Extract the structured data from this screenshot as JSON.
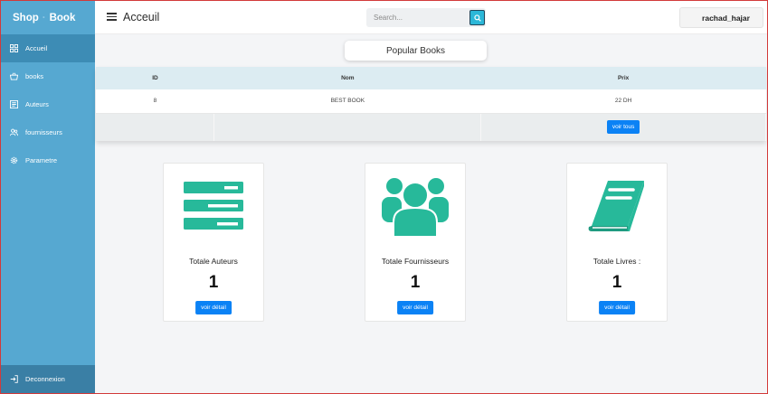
{
  "brand": {
    "part1": "Shop",
    "part2": "Book"
  },
  "sidebar": {
    "items": [
      {
        "label": "Accueil",
        "icon": "dashboard-icon"
      },
      {
        "label": "books",
        "icon": "basket-icon"
      },
      {
        "label": "Auteurs",
        "icon": "list-icon"
      },
      {
        "label": "fournisseurs",
        "icon": "users-icon"
      },
      {
        "label": "Parametre",
        "icon": "gear-icon"
      }
    ],
    "active": "Accueil",
    "logout_label": "Deconnexion"
  },
  "header": {
    "title": "Acceuil",
    "search_placeholder": "Search...",
    "username": "rachad_hajar"
  },
  "popular": {
    "title": "Popular Books",
    "columns": [
      "ID",
      "Nom",
      "Prix"
    ],
    "rows": [
      {
        "id": "8",
        "nom": "BEST BOOK",
        "prix": "22 DH"
      }
    ],
    "see_all_label": "voir tous"
  },
  "cards": [
    {
      "label": "Totale Auteurs",
      "count": "1",
      "button": "voir détail",
      "icon": "server-list-icon"
    },
    {
      "label": "Totale Fournisseurs",
      "count": "1",
      "button": "voir détail",
      "icon": "group-icon"
    },
    {
      "label": "Totale Livres :",
      "count": "1",
      "button": "voir détail",
      "icon": "book-icon"
    }
  ],
  "colors": {
    "sidebar": "#56a8d1",
    "sidebar_active": "#3d8cb5",
    "accent_green": "#27b99a",
    "primary_button": "#0b82f5",
    "search_button": "#2bb7d8"
  }
}
